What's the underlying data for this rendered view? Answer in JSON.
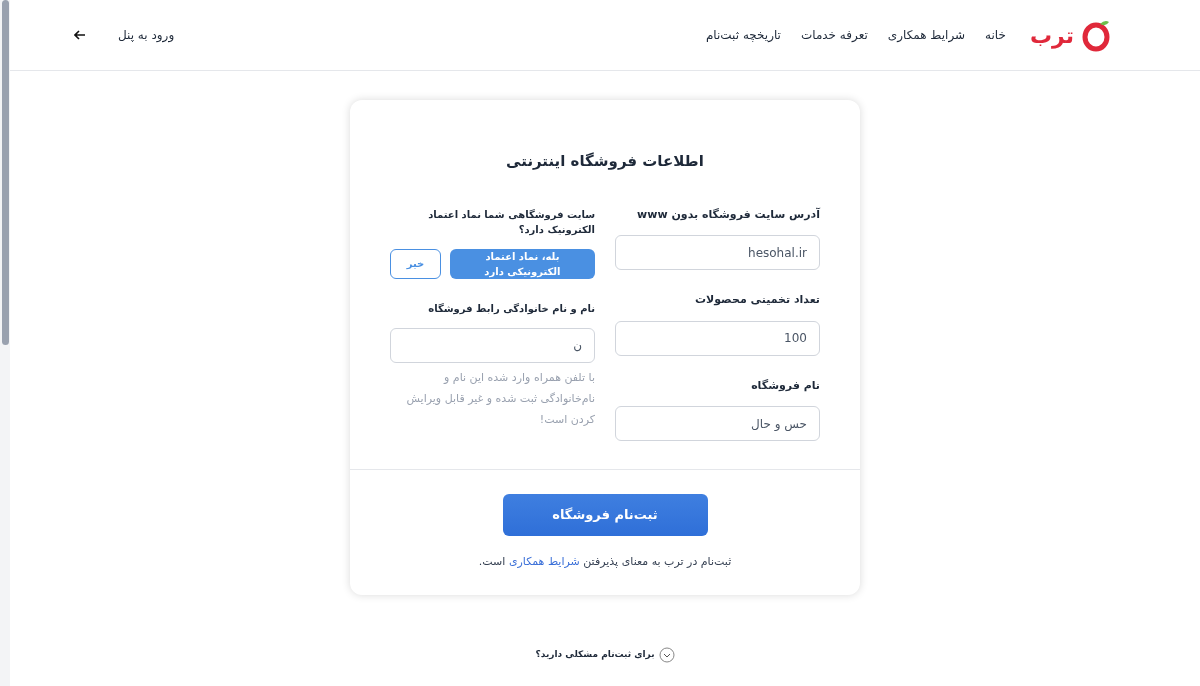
{
  "header": {
    "logo_text": "ترب",
    "nav": [
      "خانه",
      "شرایط همکاری",
      "تعرفه خدمات",
      "تاریخچه ثبت‌نام"
    ],
    "login_link": "ورود به پنل"
  },
  "form": {
    "title": "اطلاعات فروشگاه اینترنتی",
    "fields": [
      {
        "label": "آدرس سایت فروشگاه بدون www",
        "value": "hesohal.ir"
      },
      {
        "label": "تعداد تخمینی محصولات",
        "value": "100"
      },
      {
        "label": "نام فروشگاه",
        "value": "حس و حال"
      }
    ],
    "enamad": {
      "question": "سایت فروشگاهی شما نماد اعتماد الکترونیک دارد؟",
      "options": [
        {
          "label": "بله، نماد اعتماد الکترونیکی دارد",
          "selected": true
        },
        {
          "label": "خیر",
          "selected": false
        }
      ]
    },
    "contact": {
      "label": "نام و نام خانوادگی رابط فروشگاه",
      "value": "ن",
      "hint": "با تلفن همراه وارد شده این نام و نام‌خانوادگی ثبت شده و غیر قابل ویرایش کردن است!"
    },
    "submit": "ثبت‌نام فروشگاه",
    "terms": {
      "before": "ثبت‌نام در ترب به معنای پذیرفتن",
      "link": "شرایط همکاری",
      "after": "است."
    }
  },
  "help": "برای ثبت‌نام مشکلی دارید؟"
}
